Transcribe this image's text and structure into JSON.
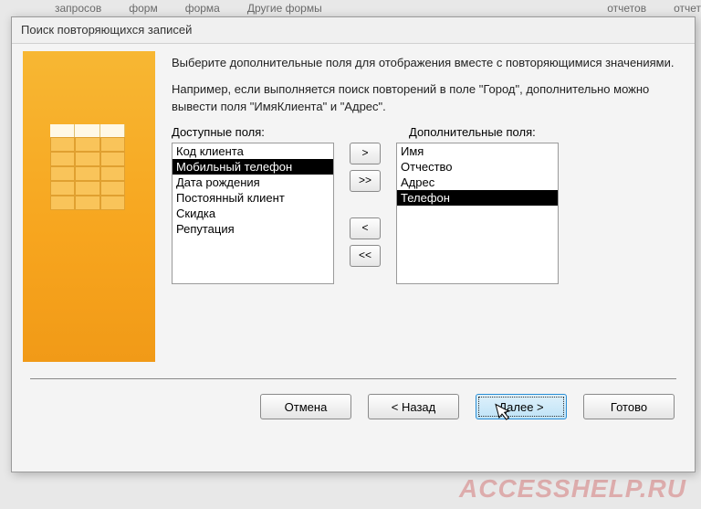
{
  "bg": {
    "a": "запросов",
    "b": "форм",
    "c": "форма",
    "d": "Другие формы",
    "e": "отчетов",
    "f": "отчет"
  },
  "dialog": {
    "title": "Поиск повторяющихся записей",
    "intro1": "Выберите дополнительные поля для отображения вместе с повторяющимися значениями.",
    "intro2": "Например, если выполняется поиск повторений в поле \"Город\", дополнительно можно вывести поля \"ИмяКлиента\" и \"Адрес\".",
    "availableLabel": "Доступные поля:",
    "selectedLabel": "Дополнительные поля:",
    "available": [
      "Код клиента",
      "Мобильный телефон",
      "Дата рождения",
      "Постоянный клиент",
      "Скидка",
      "Репутация"
    ],
    "availableSelectedIndex": 1,
    "selected": [
      "Имя",
      "Отчество",
      "Адрес",
      "Телефон"
    ],
    "selectedSelectedIndex": 3,
    "move": {
      "add": ">",
      "addAll": ">>",
      "remove": "<",
      "removeAll": "<<"
    },
    "buttons": {
      "cancel": "Отмена",
      "back": "< Назад",
      "next": "Далее >",
      "finish": "Готово"
    }
  },
  "watermark": "ACCESSHELP.RU"
}
